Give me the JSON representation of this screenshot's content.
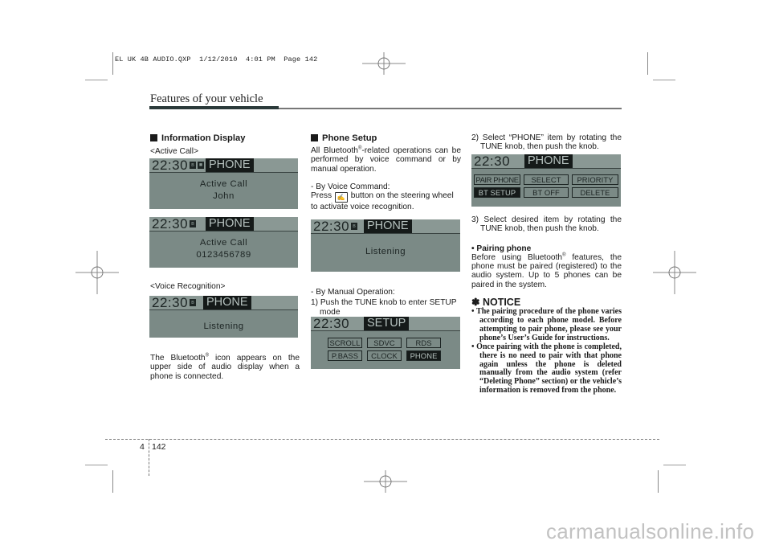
{
  "slug": "EL UK 4B AUDIO.QXP  1/12/2010  4:01 PM  Page 142",
  "header": {
    "title": "Features of your vehicle"
  },
  "footer": {
    "section_number": "4",
    "page_number": "142"
  },
  "watermark": "carmanualsonline.info",
  "icons": {
    "bluetooth": "bluetooth-icon",
    "voice_button": "voice-recognition-button-icon",
    "registration_mark": "crosshair-registration-mark"
  },
  "colors": {
    "lcd_bg": "#7b8a86",
    "lcd_header": "#8a9894",
    "lcd_text": "#1d2524",
    "lcd_highlight": "#151a19",
    "header_bar": "#2b3a3a"
  },
  "col1": {
    "heading": "Information Display",
    "active_call_label": "<Active Call>",
    "voice_label": "<Voice Recognition>",
    "bt_note_pre": "The Bluetooth",
    "bt_note_reg": "®",
    "bt_note_post": " icon appears on the upper side of audio display when a phone is connected.",
    "displays": [
      {
        "clock": "22:30",
        "mode": "PHONE",
        "line1": "Active Call",
        "line2": "John"
      },
      {
        "clock": "22:30",
        "mode": "PHONE",
        "line1": "Active Call",
        "line2": "0123456789"
      },
      {
        "clock": "22:30",
        "mode": "PHONE",
        "line1": "Listening"
      }
    ]
  },
  "col2": {
    "heading": "Phone Setup",
    "intro_pre": "All Bluetooth",
    "intro_reg": "®",
    "intro_post": "-related operations can be performed by voice command or by manual operation.",
    "voice_cmd_label": "- By Voice Command:",
    "press_pre": "Press",
    "press_post": " button on the steering wheel to activate voice recognition.",
    "manual_label": "- By Manual Operation:",
    "step1": "1) Push the TUNE knob to enter SETUP mode",
    "listening_display": {
      "clock": "22:30",
      "mode": "PHONE",
      "line1": "Listening"
    },
    "setup_display": {
      "clock": "22:30",
      "mode": "SETUP",
      "items": [
        "SCROLL",
        "SDVC",
        "RDS",
        "P.BASS",
        "CLOCK",
        "PHONE"
      ],
      "selected": "PHONE"
    }
  },
  "col3": {
    "step2": "2) Select “PHONE” item by rotating the TUNE knob, then push the knob.",
    "phone_display": {
      "clock": "22:30",
      "mode": "PHONE",
      "items": [
        "PAIR PHONE",
        "SELECT",
        "PRIORITY",
        "BT SETUP",
        "BT OFF",
        "DELETE"
      ],
      "selected": "BT SETUP"
    },
    "step3": "3) Select desired item by rotating the TUNE knob, then push the knob.",
    "pairing_heading": "• Pairing phone",
    "pairing_pre": "Before using Bluetooth",
    "pairing_reg": "®",
    "pairing_post": " features, the phone must be paired (registered) to the audio system. Up to 5 phones can be paired in the system.",
    "notice_heading": "✽ NOTICE",
    "notice_items": [
      "• The pairing procedure of the phone varies according to each phone model. Before attempting to pair phone, please see your phone’s User’s Guide for instructions.",
      "• Once pairing with the phone is completed, there is no need to pair with that phone again unless the phone is deleted manually from the audio system (refer “Deleting Phone” section) or the vehicle’s information is removed from the phone."
    ]
  }
}
